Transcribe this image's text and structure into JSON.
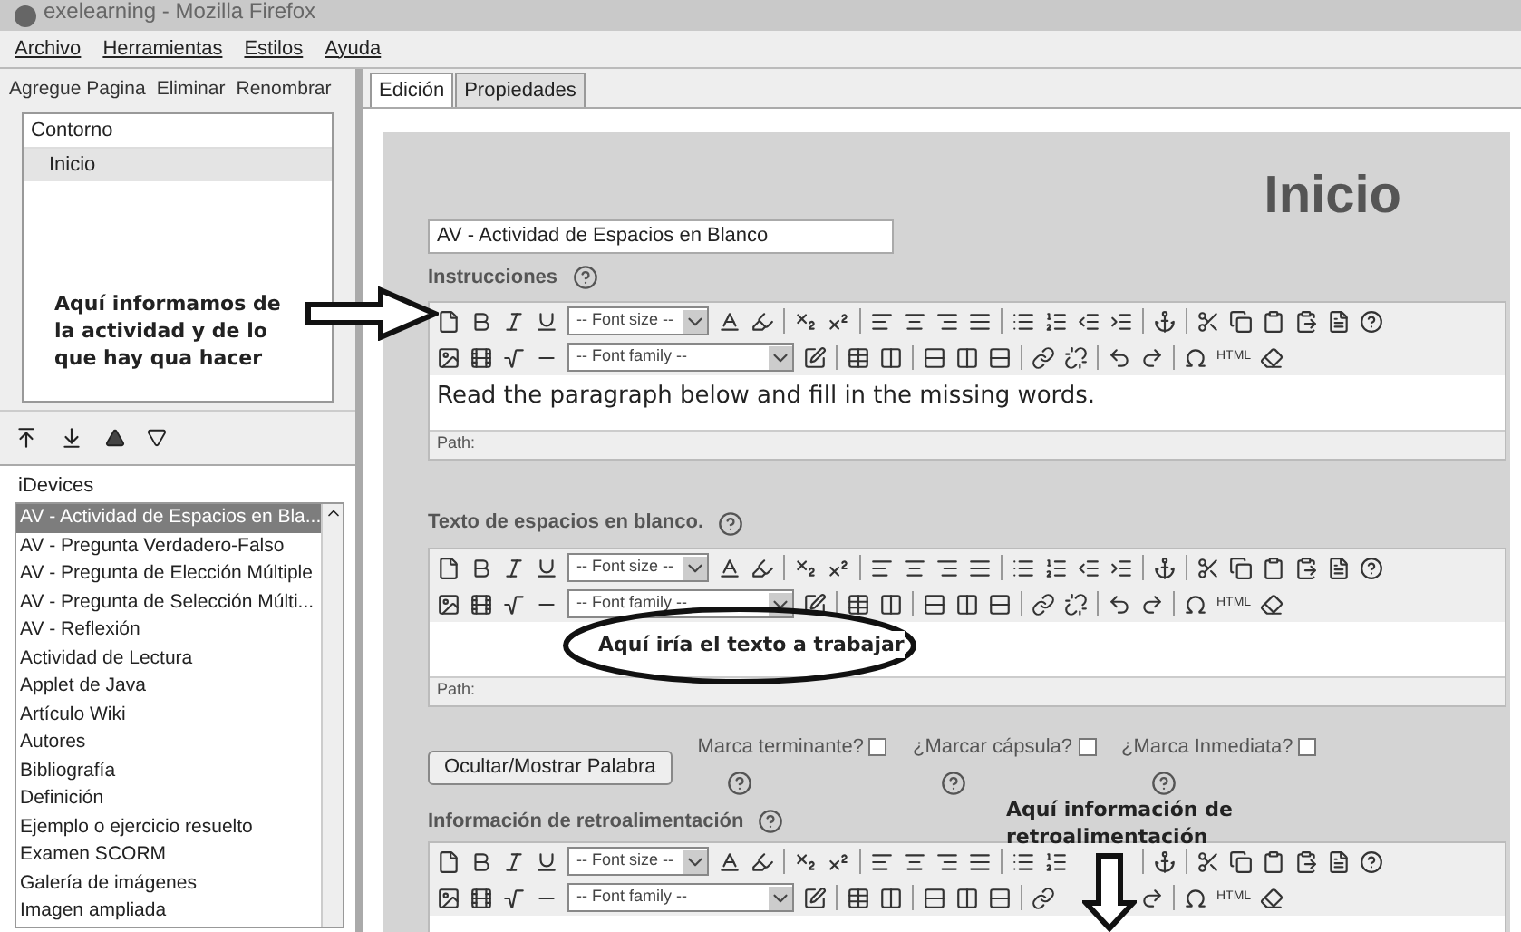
{
  "window": {
    "title": "exelearning - Mozilla Firefox"
  },
  "menu": [
    {
      "label": "Archivo"
    },
    {
      "label": "Herramientas"
    },
    {
      "label": "Estilos"
    },
    {
      "label": "Ayuda"
    }
  ],
  "outline_toolbar": [
    {
      "label": "Agregue Pagina"
    },
    {
      "label": "Eliminar"
    },
    {
      "label": "Renombrar"
    }
  ],
  "outline": {
    "header": "Contorno",
    "items": [
      {
        "label": "Inicio",
        "selected": true
      }
    ]
  },
  "idevices": {
    "header": "iDevices",
    "items": [
      {
        "label": "AV - Actividad de Espacios en Bla...",
        "selected": true
      },
      {
        "label": "AV - Pregunta Verdadero-Falso",
        "selected": false
      },
      {
        "label": "AV - Pregunta de Elección Múltiple",
        "selected": false
      },
      {
        "label": "AV - Pregunta de Selección Múlti...",
        "selected": false
      },
      {
        "label": "AV - Reflexión",
        "selected": false
      },
      {
        "label": "Actividad de Lectura",
        "selected": false
      },
      {
        "label": "Applet de Java",
        "selected": false
      },
      {
        "label": "Artículo Wiki",
        "selected": false
      },
      {
        "label": "Autores",
        "selected": false
      },
      {
        "label": "Bibliografía",
        "selected": false
      },
      {
        "label": "Definición",
        "selected": false
      },
      {
        "label": "Ejemplo o ejercicio resuelto",
        "selected": false
      },
      {
        "label": "Examen SCORM",
        "selected": false
      },
      {
        "label": "Galería de imágenes",
        "selected": false
      },
      {
        "label": "Imagen ampliada",
        "selected": false
      }
    ]
  },
  "tabs": [
    {
      "label": "Edición",
      "selected": true
    },
    {
      "label": "Propiedades",
      "selected": false
    }
  ],
  "page_title": "Inicio",
  "idevice_title": "AV - Actividad de Espacios en Blanco",
  "instructions": {
    "label": "Instrucciones",
    "toolbar": {
      "font_size": "-- Font size --",
      "font_family": "-- Font family --",
      "html": "HTML"
    },
    "text": "Read the paragraph below and fill in the missing words.",
    "path": "Path:"
  },
  "cloze": {
    "label": "Texto de espacios en blanco.",
    "toolbar": {
      "font_size": "-- Font size --",
      "font_family": "-- Font family --",
      "html": "HTML"
    },
    "path": "Path:"
  },
  "toggle_button": "Ocultar/Mostrar Palabra",
  "options": [
    {
      "label": "Marca terminante?",
      "checked": false
    },
    {
      "label": "¿Marcar cápsula?",
      "checked": false
    },
    {
      "label": "¿Marca Inmediata?",
      "checked": false
    }
  ],
  "feedback": {
    "label": "Información de retroalimentación",
    "toolbar": {
      "font_size": "-- Font size --",
      "font_family": "-- Font family --",
      "html": "HTML"
    }
  },
  "annotations": [
    {
      "kind": "arrow-right",
      "text": "Aquí informamos de la actividad y de lo que hay qua hacer"
    },
    {
      "kind": "ellipse",
      "text": "Aquí iría el texto a trabajar"
    },
    {
      "kind": "arrow-down",
      "text": "Aquí información de retroalimentación"
    }
  ]
}
